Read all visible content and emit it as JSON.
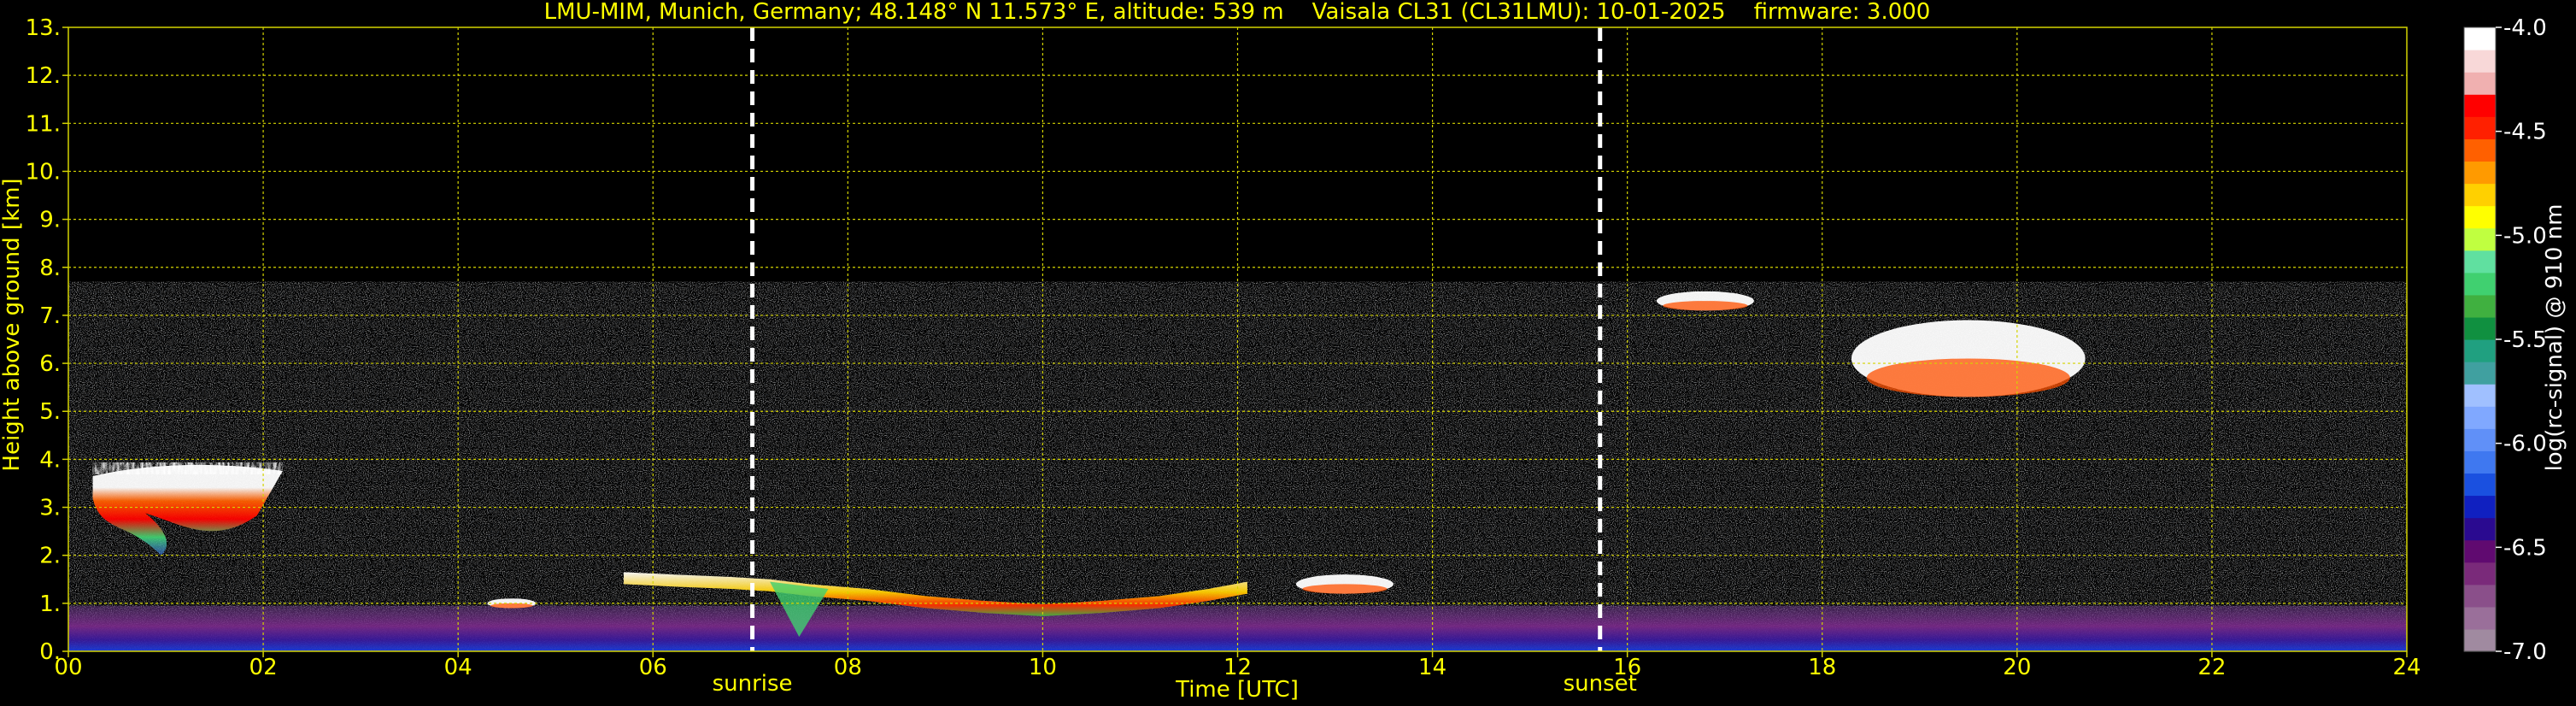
{
  "chart_data": {
    "type": "heatmap",
    "title": "LMU-MIM, Munich, Germany; 48.148° N 11.573° E, altitude: 539 m    Vaisala CL31 (CL31LMU): 10-01-2025    firmware: 3.000",
    "xlabel": "Time [UTC]",
    "ylabel": "Height above ground [km]",
    "xlim": [
      0,
      24
    ],
    "ylim": [
      0,
      13
    ],
    "x_ticks": [
      "00",
      "02",
      "04",
      "06",
      "08",
      "10",
      "12",
      "14",
      "16",
      "18",
      "20",
      "22",
      "24"
    ],
    "y_ticks": [
      "0.",
      "1.",
      "2.",
      "3.",
      "4.",
      "5.",
      "6.",
      "7.",
      "8.",
      "9.",
      "10.",
      "11.",
      "12.",
      "13."
    ],
    "grid": true,
    "grid_color": "#d4d400",
    "text_color": "#ffff00",
    "background_color": "#000000",
    "signal_top_km": 7.7,
    "events": [
      {
        "label": "sunrise",
        "time_h": 7.02
      },
      {
        "label": "sunset",
        "time_h": 15.72
      }
    ],
    "colorbar": {
      "label": "log(rc-signal) @ 910 nm",
      "range": [
        -7.0,
        -4.0
      ],
      "ticks": [
        "-4.0",
        "-4.5",
        "-5.0",
        "-5.5",
        "-6.0",
        "-6.5",
        "-7.0"
      ],
      "colors": [
        "#a08aa0",
        "#9a6f9a",
        "#8a4f8a",
        "#7a2a7a",
        "#600a70",
        "#2a0a90",
        "#1020c0",
        "#1a50e0",
        "#3f78f0",
        "#6090f8",
        "#80a8ff",
        "#a0c0ff",
        "#40a0a0",
        "#20a080",
        "#109040",
        "#40b040",
        "#40d070",
        "#60e0a0",
        "#c0ff40",
        "#ffff00",
        "#ffd000",
        "#ff9a00",
        "#ff6000",
        "#ff2000",
        "#ff0000",
        "#f0b0b0",
        "#f8d8d8",
        "#ffffff"
      ]
    },
    "features": [
      {
        "name": "boundary layer",
        "t0": 0.0,
        "t1": 24.0,
        "h0": 0.0,
        "h1": 0.95
      },
      {
        "name": "cloud deck",
        "t0": 0.25,
        "t1": 2.2,
        "h0": 2.0,
        "h1": 3.9
      },
      {
        "name": "cloud",
        "t0": 4.3,
        "t1": 4.8,
        "h0": 0.9,
        "h1": 1.1
      },
      {
        "name": "low cloud layer",
        "t0": 5.7,
        "t1": 12.1,
        "h0": 0.85,
        "h1": 1.7
      },
      {
        "name": "cloud",
        "t0": 12.6,
        "t1": 13.6,
        "h0": 1.2,
        "h1": 1.6
      },
      {
        "name": "high cloud",
        "t0": 16.3,
        "t1": 17.3,
        "h0": 7.1,
        "h1": 7.5
      },
      {
        "name": "high cloud",
        "t0": 18.3,
        "t1": 20.7,
        "h0": 5.3,
        "h1": 6.9
      }
    ]
  }
}
